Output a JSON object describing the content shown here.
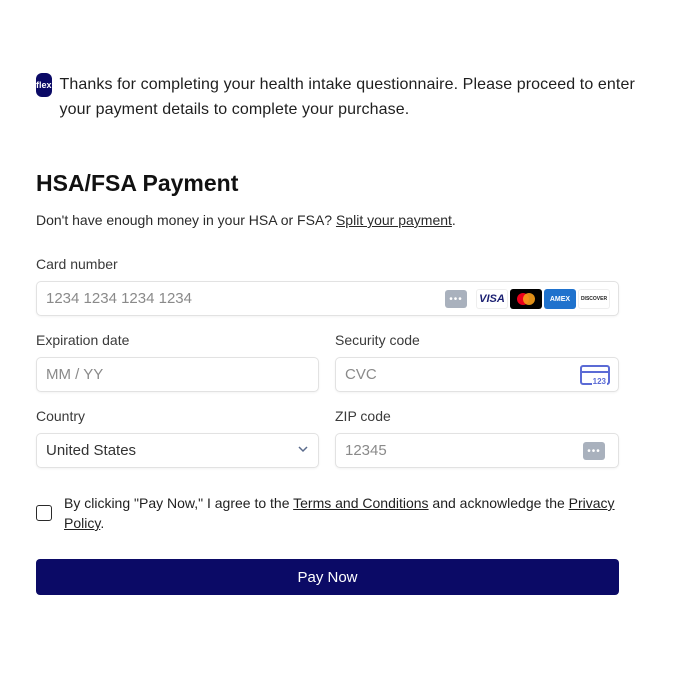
{
  "notice": {
    "logo_text": "flex",
    "message": "Thanks for completing your health intake questionnaire. Please proceed to enter your payment details to complete your purchase."
  },
  "payment": {
    "title": "HSA/FSA Payment",
    "subtitle_prefix": "Don't have enough money in your HSA or FSA? ",
    "split_link": "Split your payment",
    "subtitle_suffix": "."
  },
  "form": {
    "card_number": {
      "label": "Card number",
      "placeholder": "1234 1234 1234 1234"
    },
    "expiration": {
      "label": "Expiration date",
      "placeholder": "MM / YY"
    },
    "security": {
      "label": "Security code",
      "placeholder": "CVC",
      "icon_text": "123"
    },
    "country": {
      "label": "Country",
      "value": "United States"
    },
    "zip": {
      "label": "ZIP code",
      "placeholder": "12345"
    }
  },
  "card_brands": [
    "VISA",
    "Mastercard",
    "AMEX",
    "DISCOVER"
  ],
  "terms": {
    "prefix": "By clicking \"Pay Now,\" I agree to the ",
    "terms_link": "Terms and Conditions",
    "middle": " and acknowledge the ",
    "privacy_link": "Privacy Policy",
    "suffix": "."
  },
  "pay_button": "Pay Now",
  "colors": {
    "brand": "#0b0a66",
    "cvc_accent": "#5b6bd5"
  }
}
